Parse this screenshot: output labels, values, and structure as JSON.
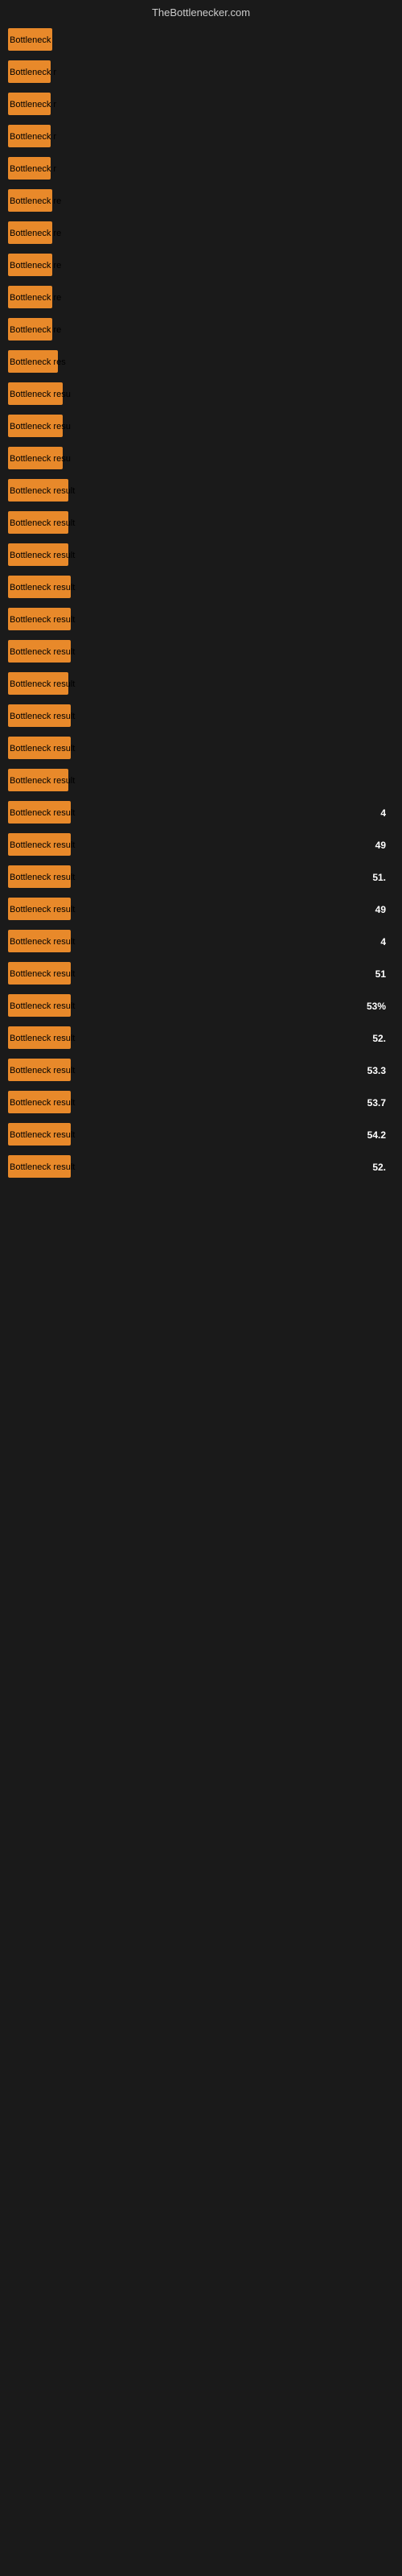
{
  "header": {
    "title": "TheBottlenecker.com"
  },
  "bars": [
    {
      "label": "Bottleneck",
      "width": 55,
      "value": "",
      "show_value": false
    },
    {
      "label": "Bottleneck r",
      "width": 53,
      "value": "",
      "show_value": false
    },
    {
      "label": "Bottleneck r",
      "width": 53,
      "value": "",
      "show_value": false
    },
    {
      "label": "Bottleneck r",
      "width": 53,
      "value": "",
      "show_value": false
    },
    {
      "label": "Bottleneck r",
      "width": 53,
      "value": "",
      "show_value": false
    },
    {
      "label": "Bottleneck re",
      "width": 55,
      "value": "",
      "show_value": false
    },
    {
      "label": "Bottleneck re",
      "width": 55,
      "value": "",
      "show_value": false
    },
    {
      "label": "Bottleneck re",
      "width": 55,
      "value": "",
      "show_value": false
    },
    {
      "label": "Bottleneck re",
      "width": 55,
      "value": "",
      "show_value": false
    },
    {
      "label": "Bottleneck re",
      "width": 55,
      "value": "",
      "show_value": false
    },
    {
      "label": "Bottleneck res",
      "width": 62,
      "value": "",
      "show_value": false
    },
    {
      "label": "Bottleneck resu",
      "width": 68,
      "value": "",
      "show_value": false
    },
    {
      "label": "Bottleneck resu",
      "width": 68,
      "value": "",
      "show_value": false
    },
    {
      "label": "Bottleneck resu",
      "width": 68,
      "value": "",
      "show_value": false
    },
    {
      "label": "Bottleneck result",
      "width": 75,
      "value": "",
      "show_value": false
    },
    {
      "label": "Bottleneck result",
      "width": 75,
      "value": "",
      "show_value": false
    },
    {
      "label": "Bottleneck result",
      "width": 75,
      "value": "",
      "show_value": false
    },
    {
      "label": "Bottleneck result",
      "width": 78,
      "value": "",
      "show_value": false
    },
    {
      "label": "Bottleneck result",
      "width": 78,
      "value": "",
      "show_value": false
    },
    {
      "label": "Bottleneck result",
      "width": 78,
      "value": "",
      "show_value": false
    },
    {
      "label": "Bottleneck result",
      "width": 75,
      "value": "",
      "show_value": false
    },
    {
      "label": "Bottleneck result",
      "width": 78,
      "value": "",
      "show_value": false
    },
    {
      "label": "Bottleneck result",
      "width": 78,
      "value": "",
      "show_value": false
    },
    {
      "label": "Bottleneck result",
      "width": 75,
      "value": "",
      "show_value": false
    },
    {
      "label": "Bottleneck result",
      "width": 78,
      "value": "4",
      "show_value": true
    },
    {
      "label": "Bottleneck result",
      "width": 78,
      "value": "49",
      "show_value": true
    },
    {
      "label": "Bottleneck result",
      "width": 78,
      "value": "51.",
      "show_value": true
    },
    {
      "label": "Bottleneck result",
      "width": 78,
      "value": "49",
      "show_value": true
    },
    {
      "label": "Bottleneck result",
      "width": 78,
      "value": "4",
      "show_value": true
    },
    {
      "label": "Bottleneck result",
      "width": 78,
      "value": "51",
      "show_value": true
    },
    {
      "label": "Bottleneck result",
      "width": 78,
      "value": "53%",
      "show_value": true
    },
    {
      "label": "Bottleneck result",
      "width": 78,
      "value": "52.",
      "show_value": true
    },
    {
      "label": "Bottleneck result",
      "width": 78,
      "value": "53.3",
      "show_value": true
    },
    {
      "label": "Bottleneck result",
      "width": 78,
      "value": "53.7",
      "show_value": true
    },
    {
      "label": "Bottleneck result",
      "width": 78,
      "value": "54.2",
      "show_value": true
    },
    {
      "label": "Bottleneck result",
      "width": 78,
      "value": "52.",
      "show_value": true
    }
  ]
}
